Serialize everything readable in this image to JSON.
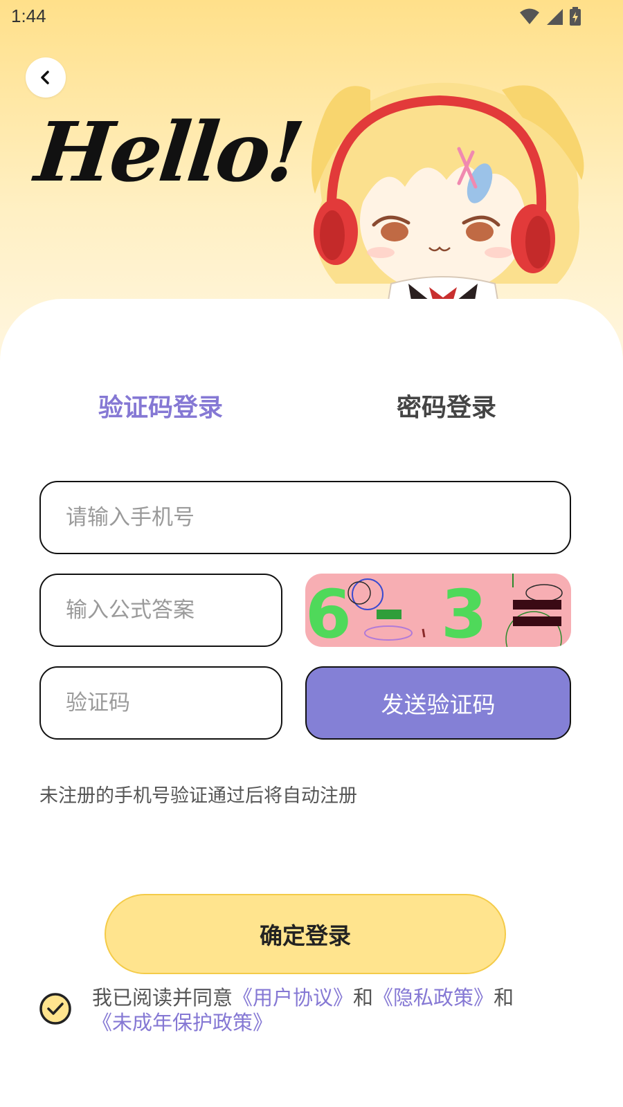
{
  "status_bar": {
    "time": "1:44",
    "icons": [
      "wifi-icon",
      "cellular-signal-icon",
      "battery-charging-icon"
    ]
  },
  "header": {
    "back_icon": "chevron-left-icon",
    "greeting": "Hello!",
    "illustration": "anime-girl-headphones-mascot"
  },
  "tabs": [
    {
      "label": "验证码登录",
      "active": true
    },
    {
      "label": "密码登录",
      "active": false
    }
  ],
  "form": {
    "phone_placeholder": "请输入手机号",
    "formula_placeholder": "输入公式答案",
    "code_placeholder": "验证码",
    "captcha_text": "6-3=",
    "send_code_label": "发送验证码"
  },
  "note": "未注册的手机号验证通过后将自动注册",
  "confirm_label": "确定登录",
  "agreement": {
    "checked": true,
    "prefix": "我已阅读并同意",
    "user_agreement": "《用户协议》",
    "and1": "和",
    "privacy_policy": "《隐私政策》",
    "and2": "和",
    "minor_policy": "《未成年保护政策》"
  },
  "colors": {
    "accent": "#8578d4",
    "button_yellow": "#ffe48e",
    "hero_yellow": "#ffe08a",
    "captcha_bg": "#f7aeb3",
    "captcha_digits": "#4fd95a"
  }
}
